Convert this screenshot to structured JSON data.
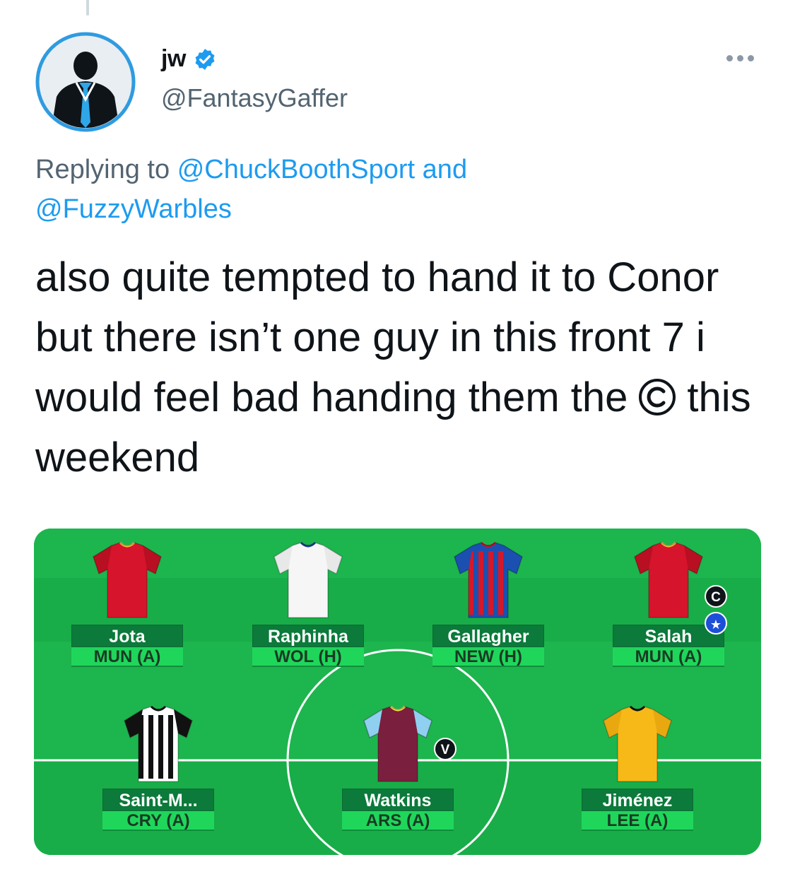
{
  "tweet": {
    "display_name": "jw",
    "handle": "@FantasyGaffer",
    "replying_prefix": "Replying to",
    "reply_to_1": "@ChuckBoothSport",
    "reply_and": "and",
    "reply_to_2": "@FuzzyWarbles",
    "text_before_emoji": "also quite tempted to hand it to Conor but there isn’t one guy in this front 7 i would feel bad handing them the",
    "emoji": "copyright-emoji",
    "text_after_emoji": "this weekend"
  },
  "icons": {
    "avatar": "suited-man-avatar-icon",
    "verified": "verified-badge-icon",
    "more": "more-options-icon"
  },
  "colors": {
    "link": "#1d9bf0",
    "secondary_text": "#536471",
    "pitch": "#19b24a",
    "name_plate": "#0b7a3a",
    "fixture_plate": "#1fd65b"
  },
  "team": {
    "players": [
      {
        "name": "Jota",
        "fixture": "MUN (A)",
        "shirt": "liverpool-red",
        "captain": false,
        "vice": false
      },
      {
        "name": "Raphinha",
        "fixture": "WOL (H)",
        "shirt": "leeds-white",
        "captain": false,
        "vice": false
      },
      {
        "name": "Gallagher",
        "fixture": "NEW (H)",
        "shirt": "palace-red-blue",
        "captain": false,
        "vice": false
      },
      {
        "name": "Salah",
        "fixture": "MUN (A)",
        "shirt": "liverpool-red",
        "captain": true,
        "vice": false
      },
      {
        "name": "Saint-M...",
        "fixture": "CRY (A)",
        "shirt": "newcastle-stripes",
        "captain": false,
        "vice": false
      },
      {
        "name": "Watkins",
        "fixture": "ARS (A)",
        "shirt": "villa-claret",
        "captain": false,
        "vice": true
      },
      {
        "name": "Jiménez",
        "fixture": "LEE (A)",
        "shirt": "wolves-gold",
        "captain": false,
        "vice": false
      }
    ],
    "captain_label": "C",
    "vice_label": "V"
  }
}
